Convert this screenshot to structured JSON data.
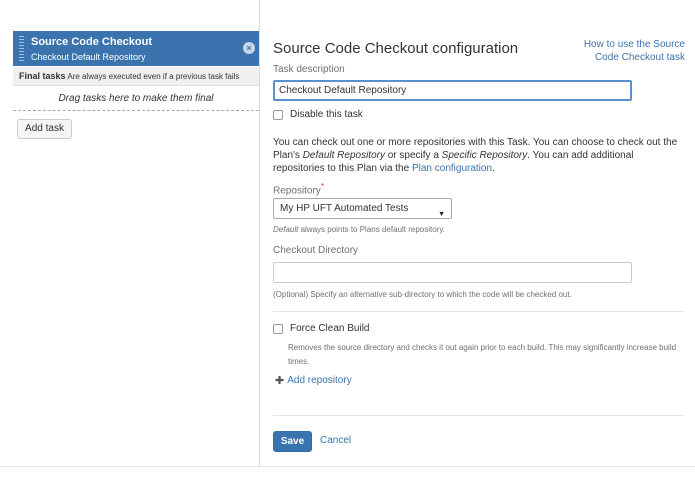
{
  "tasks_panel": {
    "task": {
      "title": "Source Code Checkout",
      "subtitle": "Checkout Default Repository",
      "remove_icon": "×"
    },
    "final_tasks": {
      "title": "Final tasks",
      "note": "Are always executed even if a previous task fails"
    },
    "drag_hint": "Drag tasks here to make them final",
    "add_task_label": "Add task"
  },
  "config": {
    "title": "Source Code Checkout configuration",
    "help_link": "How to use the Source Code Checkout task",
    "task_description_label": "Task description",
    "task_description_value": "Checkout Default Repository",
    "disable_label": "Disable this task",
    "intro": {
      "part1": "You can check out one or more repositories with this Task. You can choose to check out the Plan's ",
      "default_repo": "Default Repository",
      "part2": " or specify a ",
      "specific_repo": "Specific Repository",
      "part3": ". You can add additional repositories to this Plan via the ",
      "plan_config_link": "Plan configuration",
      "part4": "."
    },
    "repository_label": "Repository",
    "required_marker": "*",
    "repository_value": "My HP UFT Automated Tests",
    "repository_hint_em": "Default",
    "repository_hint": " always points to Plans default repository.",
    "checkout_dir_label": "Checkout Directory",
    "checkout_dir_value": "",
    "checkout_dir_hint": "(Optional) Specify an alternative sub-directory to which the code will be checked out.",
    "force_clean_label": "Force Clean Build",
    "force_clean_desc": "Removes the source directory and checks it out again prior to each build. This may significantly increase build times.",
    "add_repository_label": "Add repository",
    "save_label": "Save",
    "cancel_label": "Cancel"
  },
  "colors": {
    "accent": "#3b73af",
    "required": "#d04437",
    "focus": "#5a8fd0"
  }
}
